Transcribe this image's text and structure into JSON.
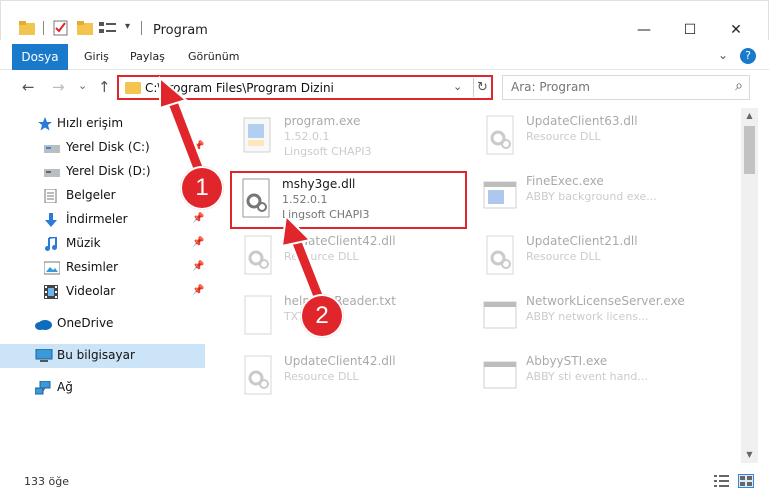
{
  "window": {
    "title": "Program",
    "minimize": "—",
    "maximize": "☐",
    "close": "✕"
  },
  "ribbon": {
    "tabs": [
      "Dosya",
      "Giriş",
      "Paylaş",
      "Görünüm"
    ],
    "collapse": "⌄",
    "help": "?"
  },
  "nav": {
    "back": "←",
    "forward": "→",
    "recent": "⌄",
    "up": "↑"
  },
  "address": {
    "path": "C:\\Program Files\\Program Dizini",
    "dropdown": "⌄",
    "refresh": "↻"
  },
  "search": {
    "placeholder": "Ara: Program",
    "icon": "⌕"
  },
  "sidebar": {
    "quick_access": "Hızlı erişim",
    "items": [
      {
        "label": "Yerel Disk (C:)",
        "icon": "drive-icon",
        "pinned": true
      },
      {
        "label": "Yerel Disk (D:)",
        "icon": "drive-icon",
        "pinned": false
      },
      {
        "label": "Belgeler",
        "icon": "document-icon",
        "pinned": true
      },
      {
        "label": "İndirmeler",
        "icon": "download-icon",
        "pinned": true
      },
      {
        "label": "Müzik",
        "icon": "music-icon",
        "pinned": true
      },
      {
        "label": "Resimler",
        "icon": "picture-icon",
        "pinned": true
      },
      {
        "label": "Videolar",
        "icon": "video-icon",
        "pinned": true
      }
    ],
    "onedrive": "OneDrive",
    "this_pc": "Bu bilgisayar",
    "network": "Ağ",
    "pin_glyph": "📌"
  },
  "files": [
    {
      "name": "program.exe",
      "line1": "1.52.0.1",
      "line2": "Lingsoft CHAPI3",
      "type": "exe",
      "faded": true
    },
    {
      "name": "UpdateClient63.dll",
      "line1": "Resource DLL",
      "line2": "",
      "type": "dll",
      "faded": true
    },
    {
      "name": "mshy3ge.dll",
      "line1": "1.52.0.1",
      "line2": "Lingsoft CHAPI3",
      "type": "dll",
      "faded": false
    },
    {
      "name": "FineExec.exe",
      "line1": "ABBY background exe...",
      "line2": "",
      "type": "app",
      "faded": true
    },
    {
      "name": "UpdateClient42.dll",
      "line1": "Resource DLL",
      "line2": "",
      "type": "dll",
      "faded": true
    },
    {
      "name": "UpdateClient21.dll",
      "line1": "Resource DLL",
      "line2": "",
      "type": "dll",
      "faded": true
    },
    {
      "name": "help_fileReader.txt",
      "line1": "TXT",
      "line2": "",
      "type": "txt",
      "faded": true
    },
    {
      "name": "NetworkLicenseServer.exe",
      "line1": "ABBY network licens...",
      "line2": "",
      "type": "app",
      "faded": true
    },
    {
      "name": "UpdateClient42.dll",
      "line1": "Resource DLL",
      "line2": "",
      "type": "dll",
      "faded": true
    },
    {
      "name": "AbbyySTI.exe",
      "line1": "ABBY sti event hand...",
      "line2": "",
      "type": "app",
      "faded": true
    }
  ],
  "status": {
    "count": "133 öğe"
  },
  "annotations": {
    "step1": "1",
    "step2": "2"
  },
  "colors": {
    "accent": "#1979ca",
    "highlight_red": "#e0262b",
    "selection": "#cce4f7"
  }
}
